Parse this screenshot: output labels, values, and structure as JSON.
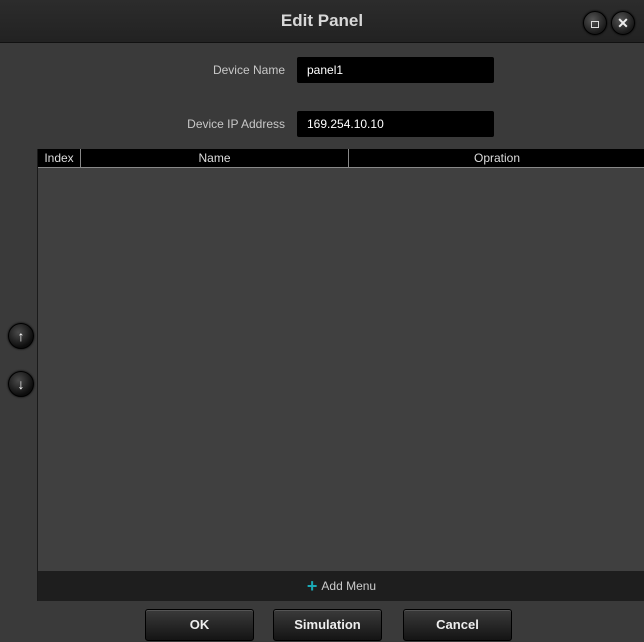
{
  "window": {
    "title": "Edit Panel",
    "maximize_icon": "maximize-icon",
    "close_symbol": "✕"
  },
  "form": {
    "device_name_label": "Device Name",
    "device_name_value": "panel1",
    "device_ip_label": "Device IP Address",
    "device_ip_value": "169.254.10.10"
  },
  "table": {
    "columns": [
      "Index",
      "Name",
      "Opration"
    ],
    "rows": []
  },
  "add_menu": {
    "label": "Add Menu",
    "icon": "plus-icon",
    "plus_symbol": "+"
  },
  "side": {
    "up_symbol": "↑",
    "down_symbol": "↓"
  },
  "buttons": {
    "ok": "OK",
    "simulation": "Simulation",
    "cancel": "Cancel"
  },
  "colors": {
    "accent": "#1aa9b5",
    "background": "#3a3a3a",
    "input_bg": "#000000"
  }
}
